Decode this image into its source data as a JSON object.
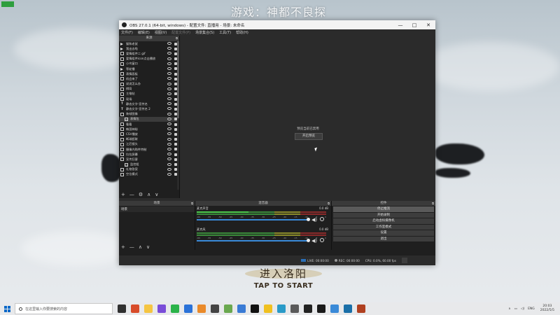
{
  "badge": "",
  "game": {
    "title": "游戏：神都不良探",
    "enter_cn": "进入洛阳",
    "enter_en": "TAP TO START"
  },
  "window": {
    "title": "OBS 27.0.1 (64-bit, windows) - 配置文件: 直播用 - 场景: 未命名",
    "menu": [
      "文件(F)",
      "编辑(E)",
      "视图(V)",
      "配置文件(P)",
      "场景集合(S)",
      "工具(T)",
      "帮助(H)"
    ],
    "menu_disabled": [
      false,
      false,
      false,
      true,
      false,
      false,
      false
    ],
    "controls": [
      "—",
      "□",
      "✕"
    ]
  },
  "sources": {
    "header": "来源",
    "items": [
      {
        "type": "play",
        "label": "猫和老鼠"
      },
      {
        "type": "play",
        "label": "我出去啦"
      },
      {
        "type": "img",
        "label": "爱情组件二 gif"
      },
      {
        "type": "img",
        "label": "爱情组件icon点击播放"
      },
      {
        "type": "img",
        "label": "小鸟窗口"
      },
      {
        "type": "play",
        "label": "等轮播"
      },
      {
        "type": "img",
        "label": "表情面板"
      },
      {
        "type": "img",
        "label": "机会来了"
      },
      {
        "type": "img",
        "label": "说说怎么办"
      },
      {
        "type": "img",
        "label": "棋局"
      },
      {
        "type": "img",
        "label": "主推帖"
      },
      {
        "type": "img",
        "label": "现场"
      },
      {
        "type": "txt",
        "label": "静态文字-宣传名"
      },
      {
        "type": "txt",
        "label": "静态文字-宣传名 2"
      },
      {
        "type": "img",
        "label": "装帧图像"
      },
      {
        "type": "folder",
        "label": "表情包",
        "selected": true,
        "indent": true
      },
      {
        "type": "img",
        "label": "看看"
      },
      {
        "type": "img",
        "label": "韩国神秘"
      },
      {
        "type": "img",
        "label": "CSV播放"
      },
      {
        "type": "img",
        "label": "断球超联"
      },
      {
        "type": "img",
        "label": "江后镜头"
      },
      {
        "type": "img",
        "label": "摄像内购件特制"
      },
      {
        "type": "img",
        "label": "拉拉屏幕"
      },
      {
        "type": "img",
        "label": "宣传狂客"
      },
      {
        "type": "folder",
        "label": "监控组",
        "indent": true
      },
      {
        "type": "img",
        "label": "礼物答案"
      },
      {
        "type": "img",
        "label": "空位模式"
      }
    ],
    "tools": [
      "+",
      "—",
      "⚙",
      "∧",
      "∨"
    ]
  },
  "preview": {
    "message": "预览当前已禁用",
    "button": "开启预览"
  },
  "scenes": {
    "header": "场景",
    "items": [
      "场景"
    ],
    "tools": [
      "+",
      "—",
      "∧",
      "∨"
    ]
  },
  "mixer": {
    "header": "混音器",
    "channels": [
      {
        "name": "麦克声音",
        "db": "0.0 dB",
        "level_fraction": 0.48
      },
      {
        "name": "麦克风",
        "db": "0.0 dB",
        "level_fraction": 0.0
      }
    ],
    "ticks": [
      "-60",
      "-55",
      "-50",
      "-45",
      "-40",
      "-35",
      "-30",
      "-25",
      "-20",
      "-15",
      "-10",
      "-5",
      "0"
    ]
  },
  "controls": {
    "header": "控件",
    "buttons": [
      "停止推流",
      "开始录制",
      "启动虚拟摄像机",
      "工作室模式",
      "设置",
      "退出"
    ]
  },
  "status": {
    "live": "LIVE: 00:00:00",
    "rec": "REC: 00:00:00",
    "cpu": "CPU: 0.0%, 60.00 fps"
  },
  "taskbar": {
    "search_placeholder": "在这里输入你要搜索的内容",
    "apps": [
      "#303030",
      "#d84c2a",
      "#f5c542",
      "#7a4dd8",
      "#2bb34a",
      "#2b72d8",
      "#ea8a2a",
      "#444",
      "#6aa84f",
      "#3a7bd5",
      "#111",
      "#f0c020",
      "#2a9ac8",
      "#5a5a5a",
      "#222",
      "#1a1a1a",
      "#3a8ad8",
      "#1a6fa8",
      "#b04020"
    ],
    "lang": "ENG",
    "time": "20:03",
    "date": "2022/5/5"
  }
}
